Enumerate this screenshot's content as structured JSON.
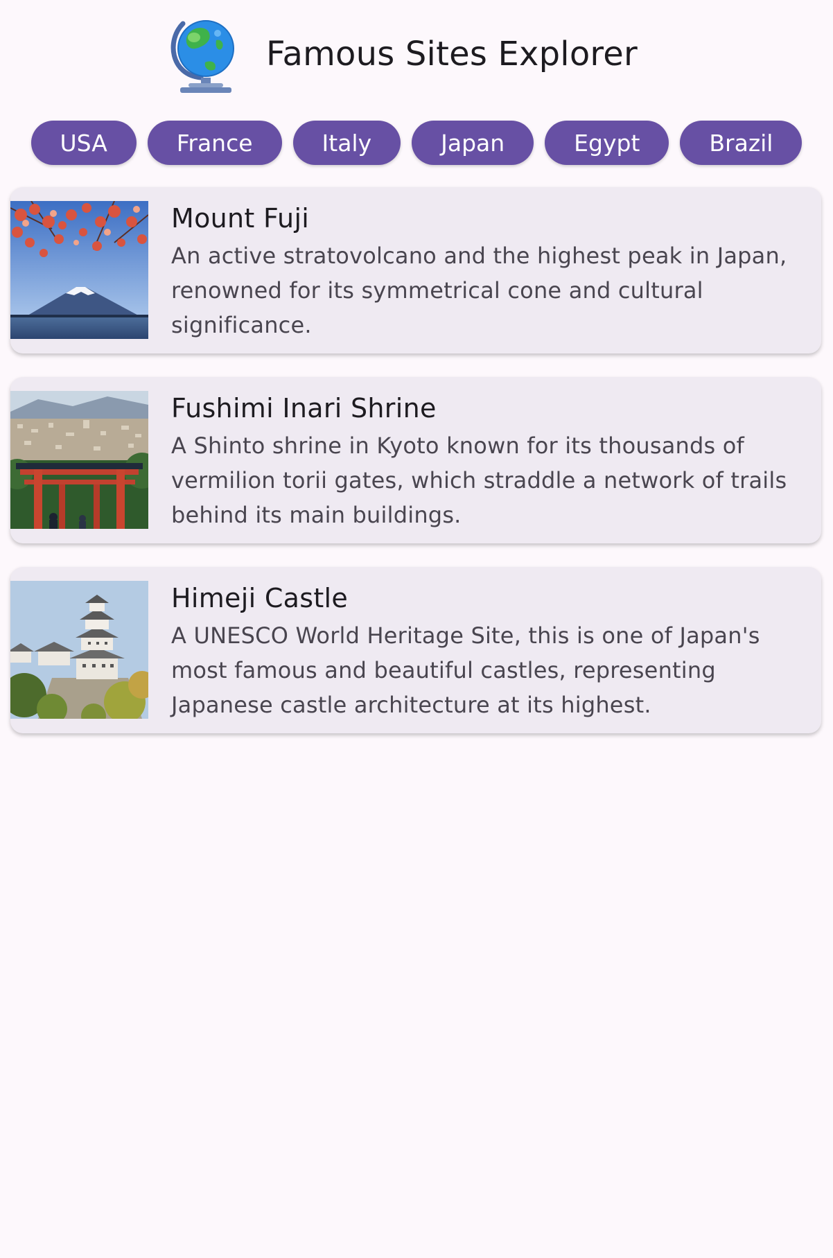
{
  "app": {
    "title": "Famous Sites Explorer",
    "icon": "globe-icon"
  },
  "countries": [
    {
      "label": "USA"
    },
    {
      "label": "France"
    },
    {
      "label": "Italy"
    },
    {
      "label": "Japan"
    },
    {
      "label": "Egypt"
    },
    {
      "label": "Brazil"
    }
  ],
  "sites": [
    {
      "name": "Mount Fuji",
      "description": "An active stratovolcano and the highest peak in Japan, renowned for its symmetrical cone and cultural significance.",
      "image": "mount-fuji-photo"
    },
    {
      "name": "Fushimi Inari Shrine",
      "description": "A Shinto shrine in Kyoto known for its thousands of vermilion torii gates, which straddle a network of trails behind its main buildings.",
      "image": "fushimi-inari-photo"
    },
    {
      "name": "Himeji Castle",
      "description": "A UNESCO World Heritage Site, this is one of Japan's most famous and beautiful castles, representing Japanese castle architecture at its highest.",
      "image": "himeji-castle-photo"
    }
  ],
  "colors": {
    "background": "#fdf8fc",
    "chip": "#6750a4",
    "chip_text": "#ffffff",
    "card": "#efeaf2",
    "title_text": "#1d1b20",
    "body_text": "#49454f"
  }
}
